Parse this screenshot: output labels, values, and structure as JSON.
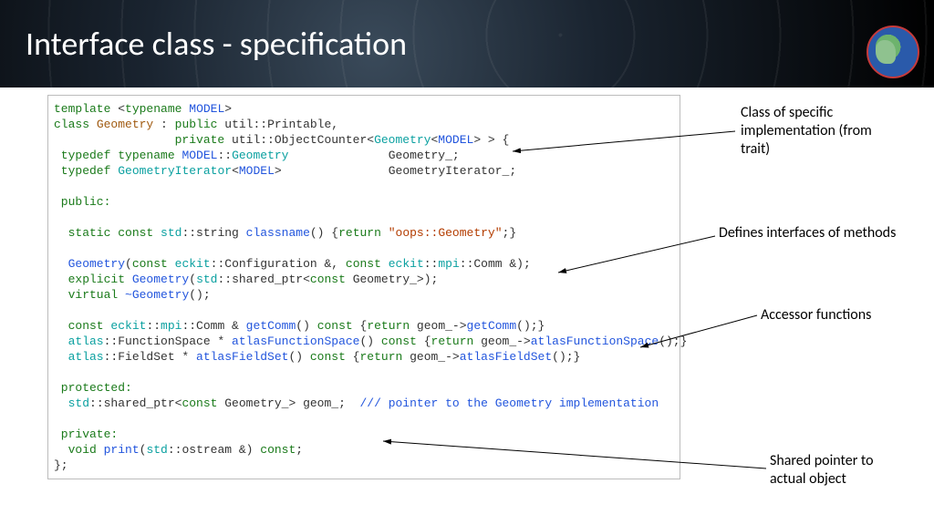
{
  "title": "Interface class - specification",
  "annotations": {
    "a1": "Class of specific implementation (from trait)",
    "a2": "Defines interfaces of methods",
    "a3": "Accessor  functions",
    "a4": "Shared pointer to actual object"
  },
  "code": {
    "l1a": "template",
    "l1b": "typename",
    "l1c": "MODEL",
    "l2a": "class",
    "l2b": "Geometry",
    "l2c": " : ",
    "l2d": "public",
    "l2e": " util::Printable,",
    "l3a": "                 ",
    "l3b": "private",
    "l3c": " util::ObjectCounter<",
    "l3d": "Geometry",
    "l3e": "MODEL",
    "l3f": "> > {",
    "l4a": " typedef typename",
    "l4b": "MODEL",
    "l4c": "::",
    "l4d": "Geometry",
    "l4e": "              Geometry_;",
    "l5a": " typedef",
    "l5b": "GeometryIterator",
    "l5c": "MODEL",
    "l5d": ">               GeometryIterator_;",
    "l7a": " public:",
    "l9a": "  static const",
    "l9b": "std",
    "l9c": "::string ",
    "l9d": "classname",
    "l9e": "() {",
    "l9f": "return",
    "l9g": "\"oops::Geometry\"",
    "l9h": ";}",
    "l11a": "  Geometry",
    "l11b": "const",
    "l11c": "eckit",
    "l11d": "::Configuration &, ",
    "l11e": "const",
    "l11f": "eckit",
    "l11g": "mpi",
    "l11h": "::Comm &);",
    "l12a": "  explicit",
    "l12b": "Geometry",
    "l12c": "std",
    "l12d": "::shared_ptr<",
    "l12e": "const",
    "l12f": " Geometry_>);",
    "l13a": "  virtual",
    "l13b": "~Geometry",
    "l13c": "();",
    "l15a": "  const",
    "l15b": "eckit",
    "l15c": "mpi",
    "l15d": "::Comm & ",
    "l15e": "getComm",
    "l15f": "() ",
    "l15g": "const",
    "l15h": " {",
    "l15i": "return",
    "l15j": " geom_->",
    "l15k": "getComm",
    "l15l": "();}",
    "l16a": "  atlas",
    "l16b": "::FunctionSpace * ",
    "l16c": "atlasFunctionSpace",
    "l16d": "() ",
    "l16e": "const",
    "l16f": " {",
    "l16g": "return",
    "l16h": " geom_->",
    "l16i": "atlasFunctionSpace",
    "l16j": "();}",
    "l17a": "  atlas",
    "l17b": "::FieldSet * ",
    "l17c": "atlasFieldSet",
    "l17d": "() ",
    "l17e": "const",
    "l17f": " {",
    "l17g": "return",
    "l17h": " geom_->",
    "l17i": "atlasFieldSet",
    "l17j": "();}",
    "l19a": " protected:",
    "l20a": "  std",
    "l20b": "::shared_ptr<",
    "l20c": "const",
    "l20d": " Geometry_> geom_;  ",
    "l20e": "/// pointer to the Geometry implementation",
    "l22a": " private:",
    "l23a": "  void",
    "l23b": "print",
    "l23c": "std",
    "l23d": "::ostream &) ",
    "l23e": "const",
    "l23f": ";",
    "l24": "};"
  }
}
